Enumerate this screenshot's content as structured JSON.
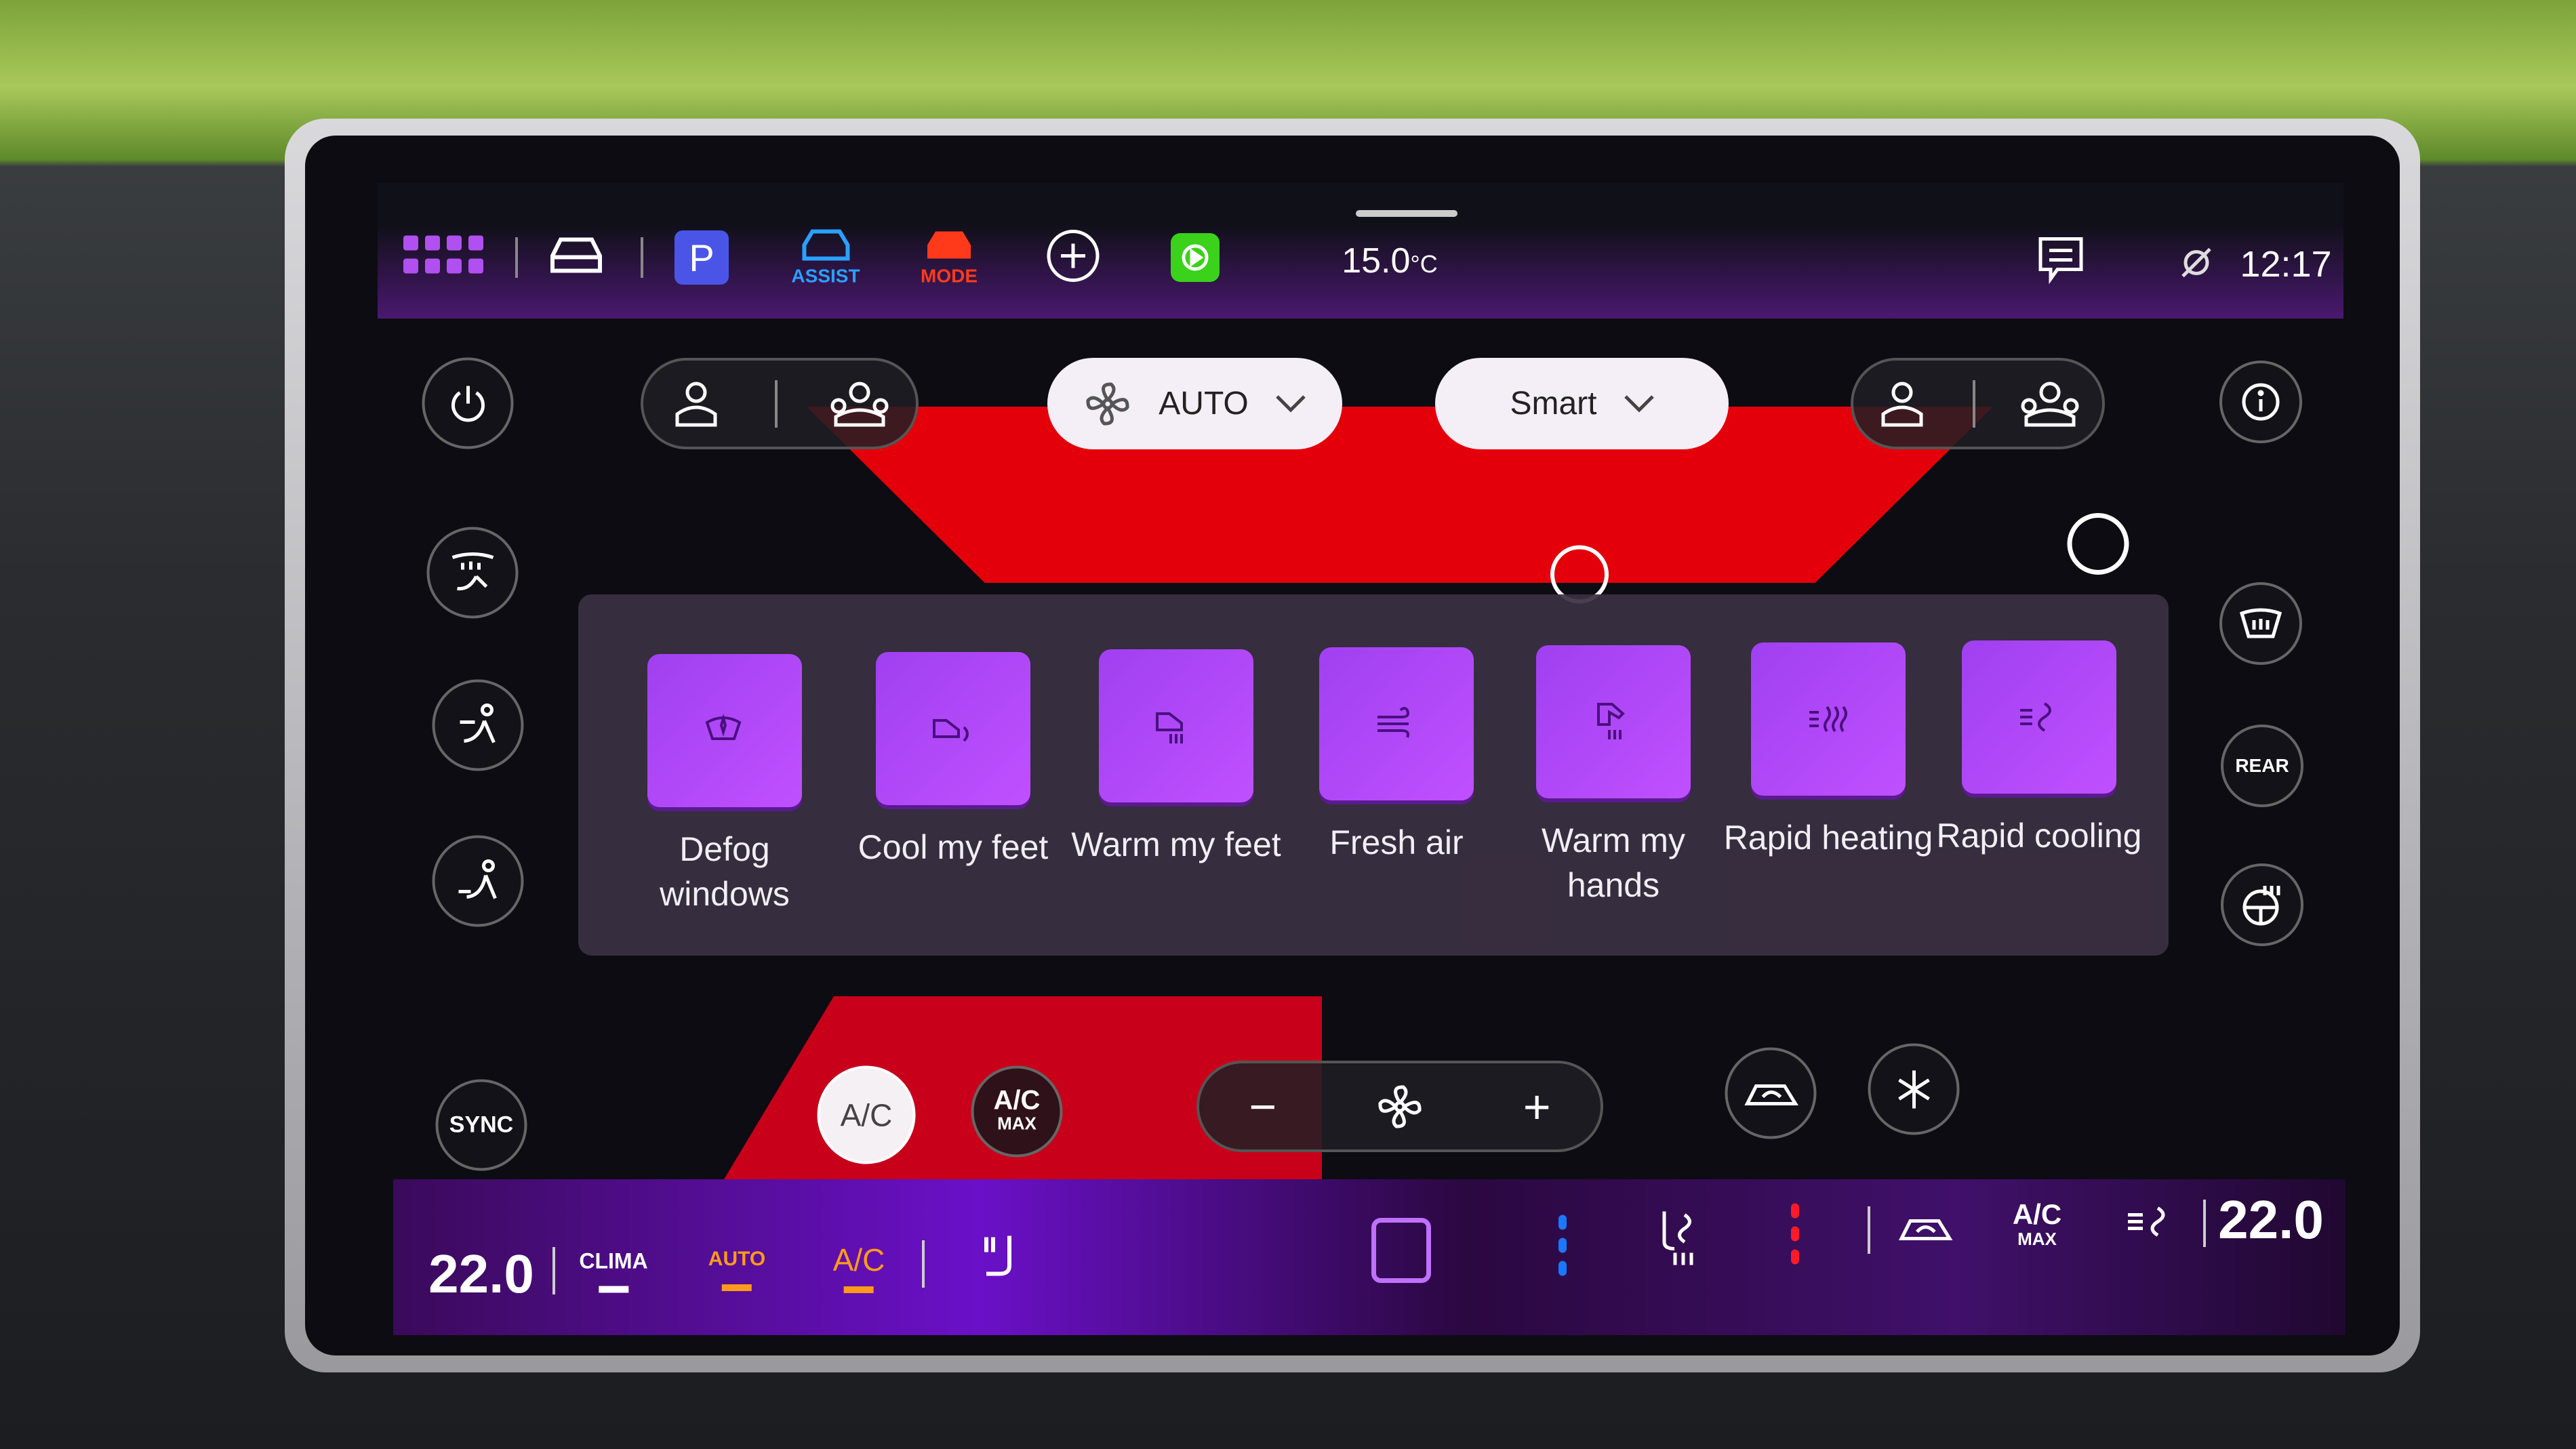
{
  "top_bar": {
    "icons": [
      "app-grid-icon",
      "car-icon",
      "parking-icon",
      "assist-icon",
      "drive-mode-icon",
      "add-icon",
      "carplay-icon"
    ],
    "parking_label": "P",
    "assist_label": "ASSIST",
    "mode_label": "MODE",
    "outside_temp": "15.0",
    "temp_unit": "°C",
    "time": "12:17",
    "right_icons": [
      "message-icon",
      "mute-icon"
    ]
  },
  "climate_header": {
    "fan_mode": "AUTO",
    "climate_style": "Smart"
  },
  "popup": {
    "items": [
      {
        "label": "Defog windows",
        "icon": "defog-icon"
      },
      {
        "label": "Cool my feet",
        "icon": "cool-feet-icon"
      },
      {
        "label": "Warm my feet",
        "icon": "warm-feet-icon"
      },
      {
        "label": "Fresh air",
        "icon": "fresh-air-icon"
      },
      {
        "label": "Warm my hands",
        "icon": "warm-hands-icon"
      },
      {
        "label": "Rapid heating",
        "icon": "rapid-heating-icon"
      },
      {
        "label": "Rapid cooling",
        "icon": "rapid-cooling-icon"
      }
    ]
  },
  "side_controls": {
    "sync_label": "SYNC",
    "rear_label": "REAR"
  },
  "bottom_controls": {
    "ac_label": "A/C",
    "ac_max_top": "A/C",
    "ac_max_bottom": "MAX",
    "fan_minus": "−",
    "fan_plus": "+"
  },
  "status_bar": {
    "left_temp": "22.0",
    "clima_label": "CLIMA",
    "auto_label": "AUTO",
    "ac_label": "A/C",
    "ac_max_top": "A/C",
    "ac_max_bottom": "MAX",
    "right_temp": "22.0",
    "left_seat_heat_level": 3,
    "right_seat_heat_level": 3
  },
  "colors": {
    "accent_purple": "#a040f0",
    "assist_blue": "#2aa0ff",
    "mode_red": "#ff3a1a",
    "carplay_green": "#3ad21a",
    "active_orange": "#ff9a1a",
    "cool_blue": "#1a78ff",
    "heat_red": "#ff1a2a"
  }
}
